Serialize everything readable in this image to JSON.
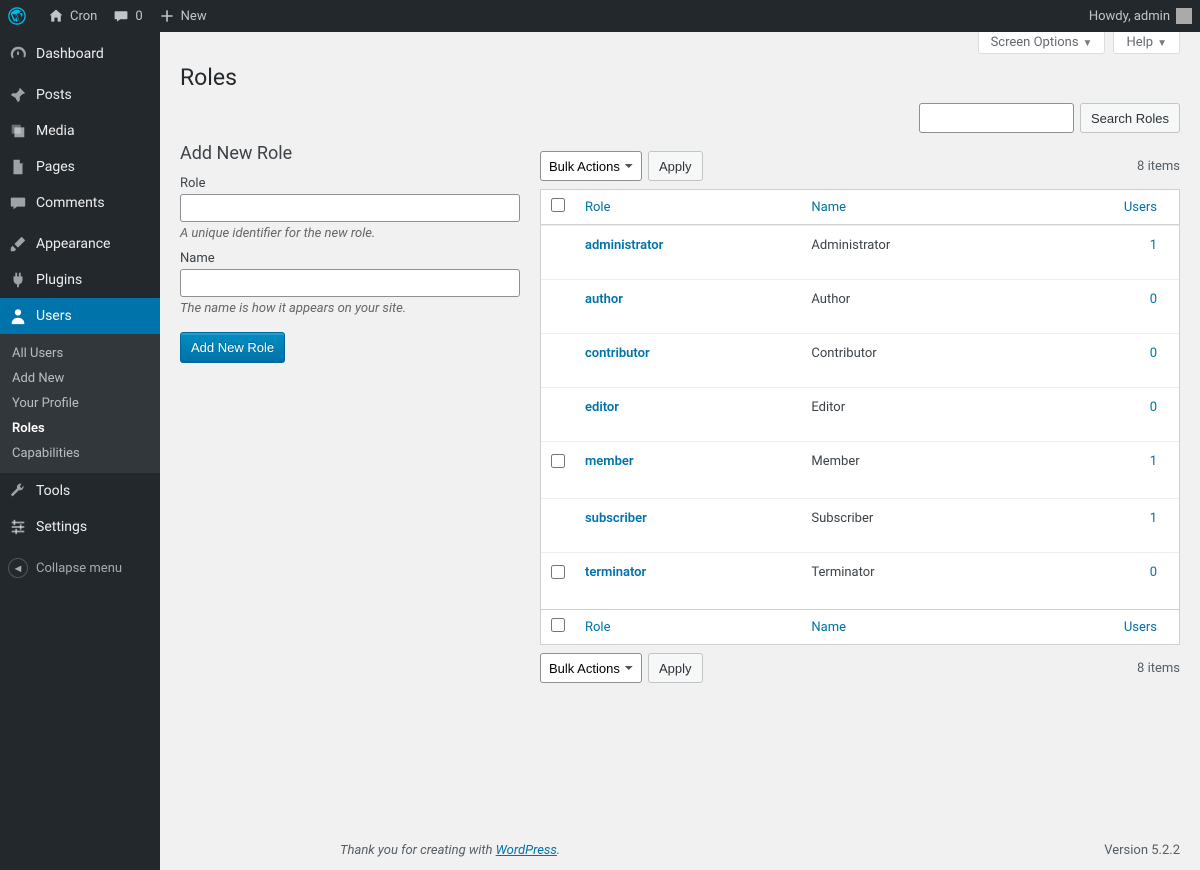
{
  "adminbar": {
    "site": "Cron",
    "comments": "0",
    "new": "New",
    "howdy": "Howdy, admin"
  },
  "sidebar": {
    "items": [
      {
        "label": "Dashboard"
      },
      {
        "label": "Posts"
      },
      {
        "label": "Media"
      },
      {
        "label": "Pages"
      },
      {
        "label": "Comments"
      },
      {
        "label": "Appearance"
      },
      {
        "label": "Plugins"
      },
      {
        "label": "Users"
      },
      {
        "label": "Tools"
      },
      {
        "label": "Settings"
      }
    ],
    "submenu": [
      {
        "label": "All Users"
      },
      {
        "label": "Add New"
      },
      {
        "label": "Your Profile"
      },
      {
        "label": "Roles"
      },
      {
        "label": "Capabilities"
      }
    ],
    "collapse": "Collapse menu"
  },
  "screen_meta": {
    "options": "Screen Options",
    "help": "Help"
  },
  "page": {
    "title": "Roles",
    "search_button": "Search Roles",
    "item_count": "8 items"
  },
  "form": {
    "heading": "Add New Role",
    "role_label": "Role",
    "role_desc": "A unique identifier for the new role.",
    "name_label": "Name",
    "name_desc": "The name is how it appears on your site.",
    "submit": "Add New Role"
  },
  "bulk": {
    "label": "Bulk Actions",
    "apply": "Apply"
  },
  "table": {
    "cols": {
      "role": "Role",
      "name": "Name",
      "users": "Users"
    },
    "rows": [
      {
        "role": "administrator",
        "name": "Administrator",
        "users": "1",
        "cb": false
      },
      {
        "role": "author",
        "name": "Author",
        "users": "0",
        "cb": false
      },
      {
        "role": "contributor",
        "name": "Contributor",
        "users": "0",
        "cb": false
      },
      {
        "role": "editor",
        "name": "Editor",
        "users": "0",
        "cb": false
      },
      {
        "role": "member",
        "name": "Member",
        "users": "1",
        "cb": true
      },
      {
        "role": "subscriber",
        "name": "Subscriber",
        "users": "1",
        "cb": false
      },
      {
        "role": "terminator",
        "name": "Terminator",
        "users": "0",
        "cb": true
      }
    ]
  },
  "footer": {
    "thank": "Thank you for creating with ",
    "wp": "WordPress",
    "period": ".",
    "version": "Version 5.2.2"
  }
}
